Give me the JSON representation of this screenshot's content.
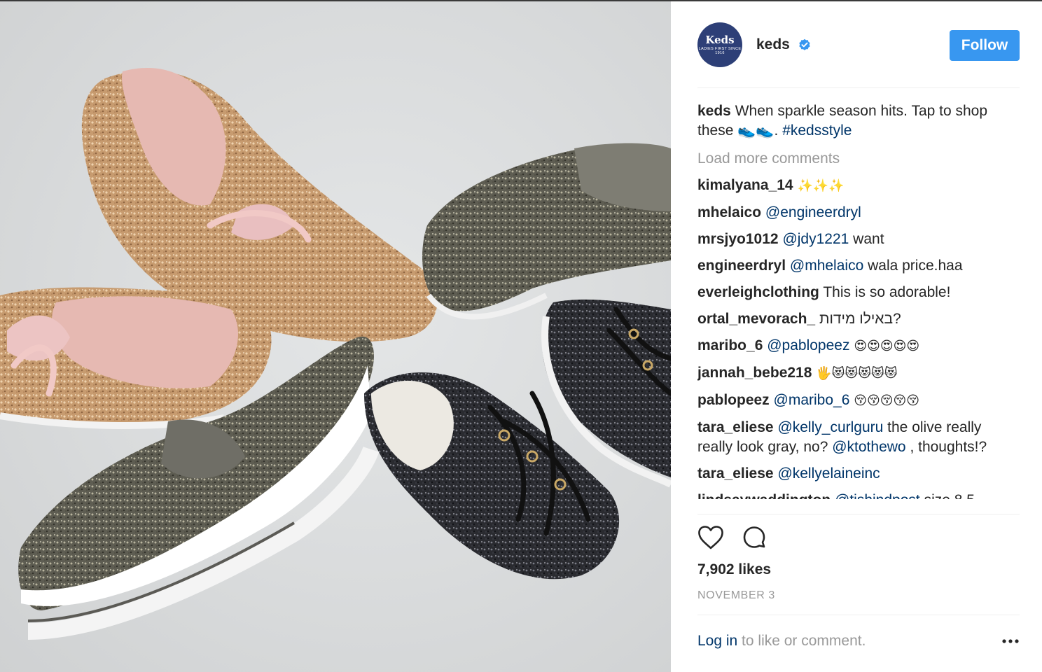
{
  "post": {
    "image_alt": "Glitter sneakers photo"
  },
  "header": {
    "avatar_brand": "Keds",
    "avatar_tagline": "LADIES FIRST SINCE 1916",
    "username": "keds",
    "follow_label": "Follow"
  },
  "caption": {
    "username": "keds",
    "text": "When sparkle season hits. Tap to shop these",
    "emoji": "👟👟",
    "punct": ".",
    "hashtag": "#kedsstyle"
  },
  "load_more": "Load more comments",
  "comments": [
    {
      "user": "kimalyana_14",
      "mention": "",
      "text": "",
      "emoji": "✨✨✨"
    },
    {
      "user": "mhelaico",
      "mention": "@engineerdryl",
      "text": "",
      "emoji": ""
    },
    {
      "user": "mrsjyo1012",
      "mention": "@jdy1221",
      "text": "want",
      "emoji": ""
    },
    {
      "user": "engineerdryl",
      "mention": "@mhelaico",
      "text": "wala price.haa",
      "emoji": ""
    },
    {
      "user": "everleighclothing",
      "mention": "",
      "text": "This is so adorable!",
      "emoji": ""
    },
    {
      "user": "ortal_mevorach_",
      "mention": "",
      "text": "באילו מידות?",
      "emoji": ""
    },
    {
      "user": "maribo_6",
      "mention": "@pablopeez",
      "text": "",
      "emoji": "😍😍😍😍😍"
    },
    {
      "user": "jannah_bebe218",
      "mention": "",
      "text": "",
      "emoji": "🖐😻😻😻😻😻"
    },
    {
      "user": "pablopeez",
      "mention": "@maribo_6",
      "text": "",
      "emoji": "😚😚😚😚😚"
    },
    {
      "user": "tara_eliese",
      "mention": "@kelly_curlguru",
      "text": "the olive really really look gray, no?",
      "mention2": "@ktothewo",
      "text2": ", thoughts!?",
      "emoji": ""
    },
    {
      "user": "tara_eliese",
      "mention": "@kellyelaineinc",
      "text": "",
      "emoji": ""
    }
  ],
  "cut_comment": {
    "user": "lindsaywaddington",
    "mention": "@tishindpost",
    "text": "size 8.5"
  },
  "likes": "7,902 likes",
  "date": "NOVEMBER 3",
  "footer": {
    "login_label": "Log in",
    "rest": " to like or comment."
  },
  "colors": {
    "follow_bg": "#3897f0",
    "link": "#003569",
    "muted": "#999999",
    "avatar_bg": "#2d3f77",
    "verified": "#3897f0"
  },
  "icons": [
    "heart-icon",
    "comment-bubble-icon",
    "verified-badge-icon",
    "more-options-icon"
  ]
}
